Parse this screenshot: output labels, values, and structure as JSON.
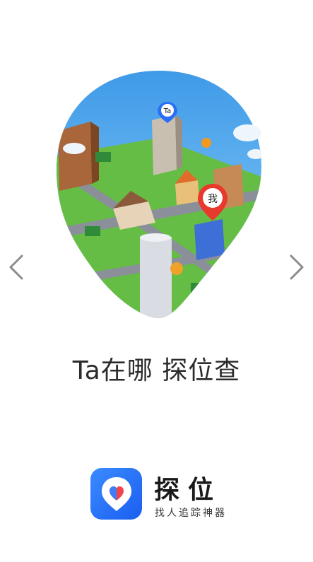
{
  "illustration": {
    "pin_ta_label": "Ta",
    "pin_me_label": "我"
  },
  "tagline": "Ta在哪 探位查",
  "brand": {
    "name": "探位",
    "slogan": "找人追踪神器"
  },
  "colors": {
    "sky": "#5fb0ee",
    "ground": "#6cc04a",
    "accent_red": "#e8392d",
    "app_icon_blue": "#2a6ff5"
  }
}
